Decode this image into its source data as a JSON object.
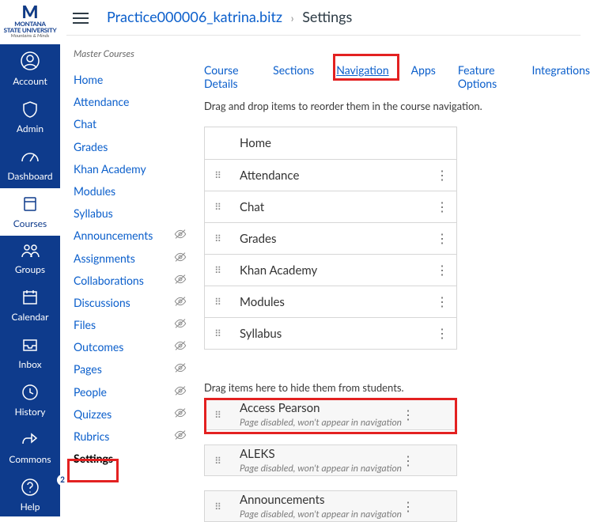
{
  "logo": {
    "uni1": "MONTANA",
    "uni2": "STATE UNIVERSITY",
    "tag": "Mountains & Minds"
  },
  "global_nav": {
    "account": "Account",
    "admin": "Admin",
    "dashboard": "Dashboard",
    "courses": "Courses",
    "groups": "Groups",
    "calendar": "Calendar",
    "inbox": "Inbox",
    "history": "History",
    "commons": "Commons",
    "help": "Help",
    "help_badge": "2"
  },
  "breadcrumb": {
    "course": "Practice000006_katrina.bitz",
    "page": "Settings"
  },
  "course_nav": {
    "heading": "Master Courses",
    "items": [
      {
        "label": "Home",
        "hidden": false,
        "active": false
      },
      {
        "label": "Attendance",
        "hidden": false,
        "active": false
      },
      {
        "label": "Chat",
        "hidden": false,
        "active": false
      },
      {
        "label": "Grades",
        "hidden": false,
        "active": false
      },
      {
        "label": "Khan Academy",
        "hidden": false,
        "active": false
      },
      {
        "label": "Modules",
        "hidden": false,
        "active": false
      },
      {
        "label": "Syllabus",
        "hidden": false,
        "active": false
      },
      {
        "label": "Announcements",
        "hidden": true,
        "active": false
      },
      {
        "label": "Assignments",
        "hidden": true,
        "active": false
      },
      {
        "label": "Collaborations",
        "hidden": true,
        "active": false
      },
      {
        "label": "Discussions",
        "hidden": true,
        "active": false
      },
      {
        "label": "Files",
        "hidden": true,
        "active": false
      },
      {
        "label": "Outcomes",
        "hidden": true,
        "active": false
      },
      {
        "label": "Pages",
        "hidden": true,
        "active": false
      },
      {
        "label": "People",
        "hidden": true,
        "active": false
      },
      {
        "label": "Quizzes",
        "hidden": true,
        "active": false
      },
      {
        "label": "Rubrics",
        "hidden": true,
        "active": false
      },
      {
        "label": "Settings",
        "hidden": false,
        "active": true
      }
    ]
  },
  "tabs": {
    "course_details": "Course Details",
    "sections": "Sections",
    "navigation": "Navigation",
    "apps": "Apps",
    "feature_options": "Feature Options",
    "integrations": "Integrations"
  },
  "instructions": {
    "reorder": "Drag and drop items to reorder them in the course navigation.",
    "hide": "Drag items here to hide them from students."
  },
  "enabled_items": [
    {
      "label": "Home",
      "grip": false,
      "kebab": false
    },
    {
      "label": "Attendance",
      "grip": true,
      "kebab": true
    },
    {
      "label": "Chat",
      "grip": true,
      "kebab": true
    },
    {
      "label": "Grades",
      "grip": true,
      "kebab": true
    },
    {
      "label": "Khan Academy",
      "grip": true,
      "kebab": true
    },
    {
      "label": "Modules",
      "grip": true,
      "kebab": true
    },
    {
      "label": "Syllabus",
      "grip": true,
      "kebab": true
    }
  ],
  "disabled_sub": "Page disabled, won't appear in navigation",
  "disabled_items": [
    {
      "label": "Access Pearson"
    },
    {
      "label": "ALEKS"
    },
    {
      "label": "Announcements"
    }
  ]
}
